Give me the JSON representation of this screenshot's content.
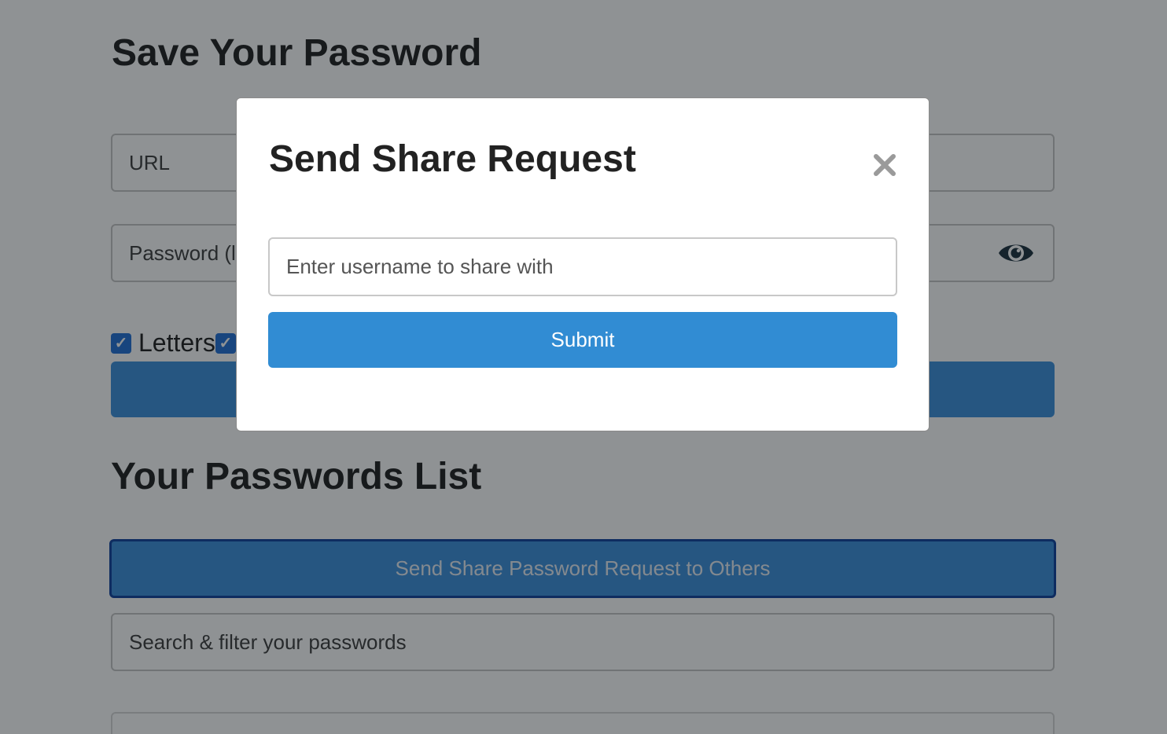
{
  "save_section": {
    "title": "Save Your Password",
    "url_placeholder": "URL",
    "password_placeholder": "Password (l",
    "checkbox_letters_label": "Letters",
    "checkbox_mark": "✓"
  },
  "list_section": {
    "title": "Your Passwords List",
    "share_button_label": "Send Share Password Request to Others",
    "search_placeholder": "Search & filter your passwords"
  },
  "modal": {
    "title": "Send Share Request",
    "close_icon": "close-icon",
    "username_placeholder": "Enter username to share with",
    "submit_label": "Submit"
  },
  "icons": {
    "eye": "eye-icon"
  },
  "colors": {
    "primary_button": "#318cd3",
    "share_button_border": "#0c3f9e",
    "checkbox": "#1f6fd6"
  }
}
